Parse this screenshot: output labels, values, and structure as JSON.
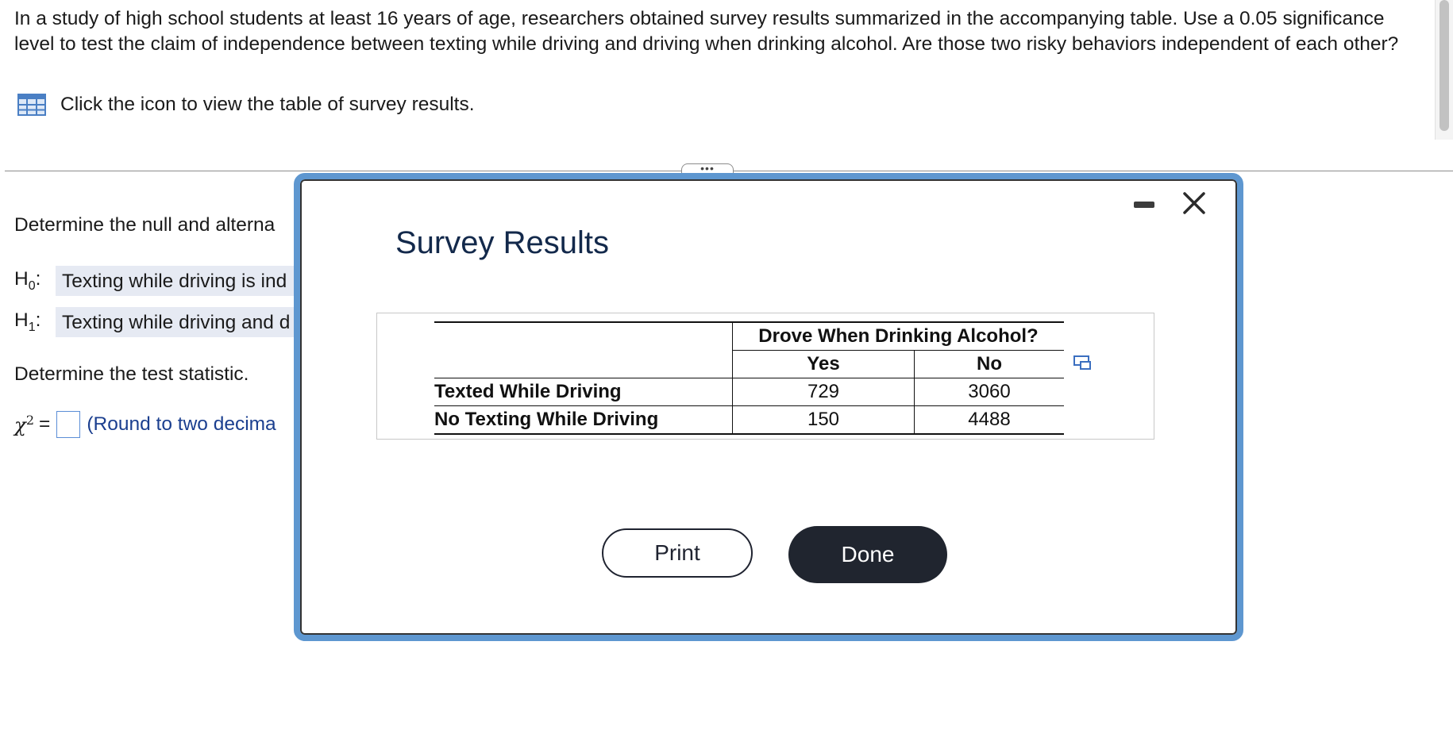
{
  "problem": {
    "text": "In a study of high school students at least 16 years of age, researchers obtained survey results summarized in the accompanying table. Use a 0.05 significance level to test the claim of independence between texting while driving and driving when drinking alcohol. Are those two risky behaviors independent of each other?",
    "table_link_label": "Click the icon to view the table of survey results.",
    "table_icon": "table-icon"
  },
  "left_pane": {
    "hypotheses_prompt": "Determine the null and alterna",
    "h0_label": "H",
    "h0_sub": "0",
    "h0_colon": ":",
    "h0_text": "Texting while driving is ind",
    "h1_label": "H",
    "h1_sub": "1",
    "h1_colon": ":",
    "h1_text": "Texting while driving and d",
    "statistic_prompt": "Determine the test statistic.",
    "chi_symbol": "χ",
    "chi_sup": "2",
    "chi_eq": "=",
    "answer_value": "",
    "round_hint": "(Round to two decima"
  },
  "modal": {
    "title": "Survey Results",
    "more_tab": "•••",
    "minimize_icon": "minimize-icon",
    "close_icon": "close-icon",
    "table": {
      "group_header": "Drove When Drinking Alcohol?",
      "columns": [
        "Yes",
        "No"
      ],
      "rows": [
        {
          "label": "Texted While Driving",
          "yes": "729",
          "no": "3060"
        },
        {
          "label": "No Texting While Driving",
          "yes": "150",
          "no": "4488"
        }
      ]
    },
    "copy_icon": "copy-icon",
    "print_label": "Print",
    "done_label": "Done"
  },
  "colors": {
    "modal_border": "#5e97d0",
    "hypothesis_bg": "#e6eaf3",
    "done_bg": "#20252f",
    "hint_text": "#1b3f8f"
  }
}
